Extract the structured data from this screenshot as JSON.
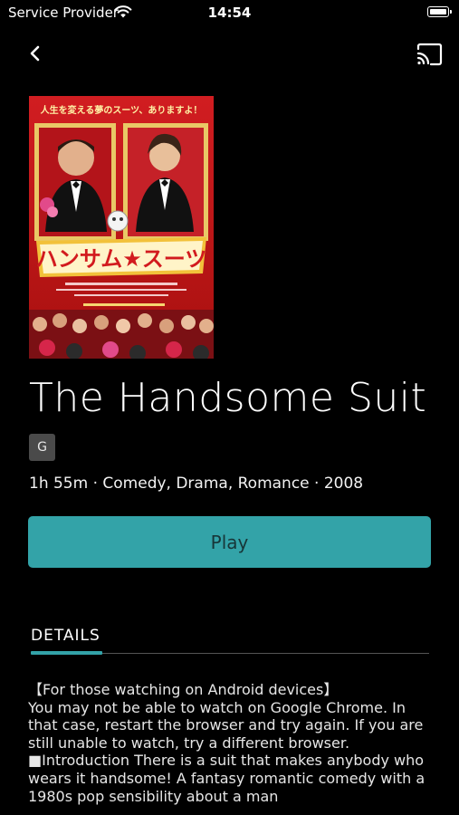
{
  "status_bar": {
    "carrier": "Service Provider",
    "time": "14:54",
    "battery_level": 1.0
  },
  "nav": {
    "back_icon": "chevron-left-icon",
    "cast_icon": "cast-icon"
  },
  "movie": {
    "title": "The Handsome Suit",
    "rating": "G",
    "meta": "1h 55m · Comedy, Drama, Romance · 2008",
    "poster": {
      "top_caption": "人生を変える夢のスーツ、ありますよ！",
      "logo_text": "ハンサム★スーツ"
    }
  },
  "actions": {
    "play_label": "Play"
  },
  "tabs": {
    "details_label": "DETAILS"
  },
  "description": "【For those watching on Android devices】\nYou may not be able to watch on Google Chrome. In that case, restart the browser and try again. If you are still unable to watch, try a different browser.\n■Introduction There is a suit that makes anybody who wears it handsome! A fantasy romantic comedy with a 1980s pop sensibility about a man",
  "colors": {
    "accent": "#33a3a8",
    "background": "#000000",
    "rating_badge": "#4a4a4a"
  }
}
